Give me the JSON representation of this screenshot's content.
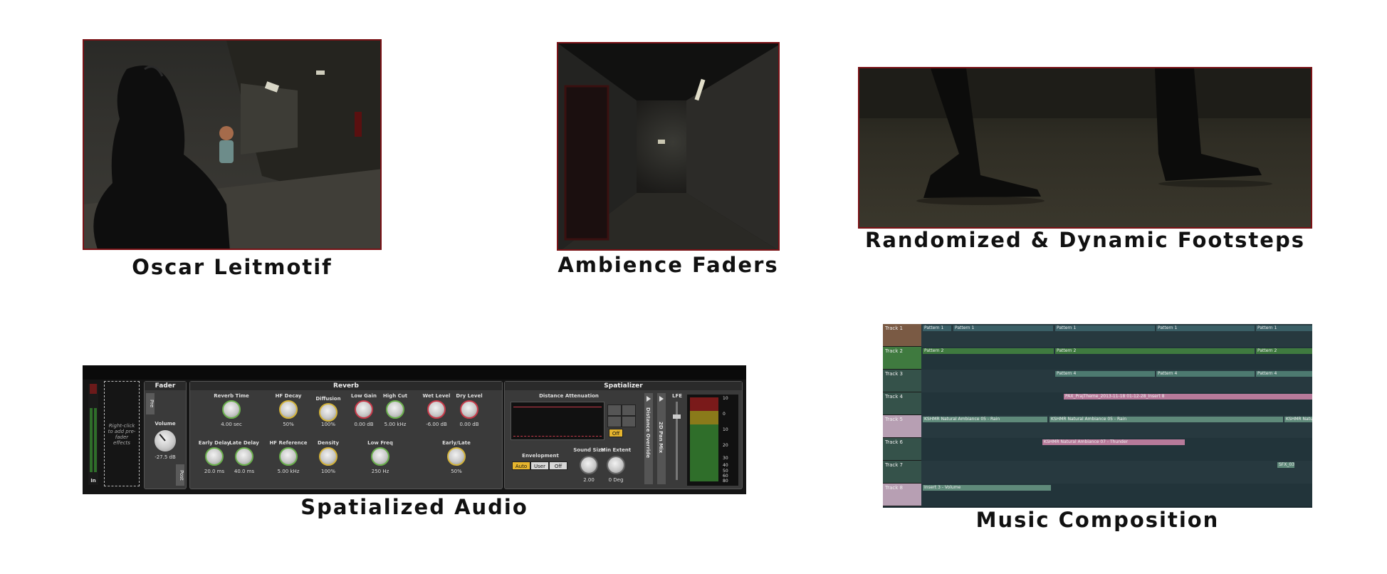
{
  "sections": {
    "oscar": {
      "caption": "Oscar Leitmotif"
    },
    "ambience": {
      "caption": "Ambience Faders"
    },
    "footsteps": {
      "caption": "Randomized & Dynamic Footsteps"
    },
    "spatial": {
      "caption": "Spatialized Audio"
    },
    "music": {
      "caption": "Music Composition"
    }
  },
  "mixer": {
    "in_label": "In",
    "insert_hint": "Right-click to add pre-fader effects",
    "fader": {
      "title": "Fader",
      "pre": "Pre",
      "post": "Post",
      "volume_label": "Volume",
      "volume_value": "-27.5 dB"
    },
    "reverb": {
      "title": "Reverb",
      "knobs_top": [
        {
          "label": "Reverb Time",
          "value": "4.00 sec"
        },
        {
          "label": "HF Decay",
          "value": "50%"
        },
        {
          "label": "Diffusion",
          "value": "100%"
        },
        {
          "label": "Low Gain",
          "value": "0.00 dB"
        },
        {
          "label": "High Cut",
          "value": "5.00 kHz"
        },
        {
          "label": "Wet Level",
          "value": "-6.00 dB"
        },
        {
          "label": "Dry Level",
          "value": "0.00 dB"
        }
      ],
      "knobs_bottom": [
        {
          "label": "Early Delay",
          "value": "20.0 ms"
        },
        {
          "label": "Late Delay",
          "value": "40.0 ms"
        },
        {
          "label": "HF Reference",
          "value": "5.00 kHz"
        },
        {
          "label": "Density",
          "value": "100%"
        },
        {
          "label": "Low Freq",
          "value": "250 Hz"
        },
        {
          "label": "Early/Late",
          "value": "50%"
        }
      ]
    },
    "spatializer": {
      "title": "Spatializer",
      "distance_attenuation": "Distance Attenuation",
      "off_button": "Off",
      "envelopment": "Envelopment",
      "env_auto": "Auto",
      "env_user": "User",
      "env_off": "Off",
      "sound_size_label": "Sound Size",
      "sound_size_value": "2.00",
      "min_extent_label": "Min Extent",
      "min_extent_value": "0 Deg",
      "distance_override": "Distance Override",
      "pan_mix": "2D Pan Mix",
      "lfe": "LFE",
      "meter_ticks": [
        "10",
        "0",
        "10",
        "20",
        "30",
        "40",
        "50",
        "60",
        "80"
      ]
    }
  },
  "daw": {
    "tracks": [
      {
        "name": "Track 1",
        "color": "#7a5a44",
        "clips": [
          "Pattern 1",
          "Pattern 1",
          "Pattern 1",
          "Pattern 1",
          "Pattern 1"
        ]
      },
      {
        "name": "Track 2",
        "color": "#3f7a3f",
        "clips": [
          "Pattern 2",
          "Pattern 2",
          "Pattern 2"
        ]
      },
      {
        "name": "Track 3",
        "color": "#35524a",
        "clips": [
          "Pattern 4",
          "Pattern 4",
          "Pattern 4"
        ]
      },
      {
        "name": "Track 4",
        "color": "#35524a",
        "clips": [
          "PAX_PrajTheme_2013-11-18 01-12-28_Insert 8"
        ]
      },
      {
        "name": "Track 5",
        "color": "#b79fb3",
        "clips": [
          "KSHMR Natural Ambiance 05 - Rain",
          "KSHMR Natural Ambiance 05 - Rain",
          "KSHMR Natu"
        ]
      },
      {
        "name": "Track 6",
        "color": "#35524a",
        "clips": [
          "KSHMR Natural Ambiance 07 - Thunder"
        ]
      },
      {
        "name": "Track 7",
        "color": "#35524a",
        "clips": [
          "SFX_03"
        ]
      },
      {
        "name": "Track 8",
        "color": "#b79fb3",
        "clips": [
          "Insert 3 - Volume"
        ]
      }
    ]
  }
}
